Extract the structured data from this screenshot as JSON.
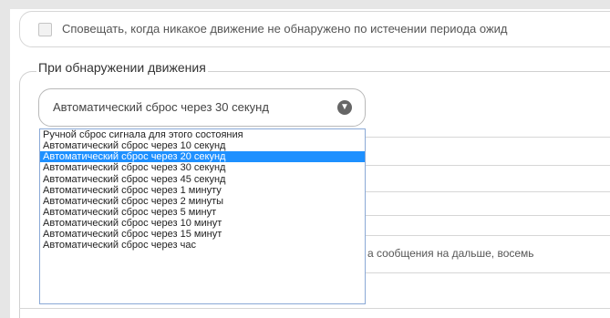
{
  "notify": {
    "label": "Сповещать, когда никакое движение не обнаружено по истечении периода ожид"
  },
  "section": {
    "title": "При обнаружении движения"
  },
  "select": {
    "value": "Автоматический сброс через 30 секунд"
  },
  "dropdown": {
    "options": [
      "Ручной сброс сигнала для этого состояния",
      "Автоматический сброс через 10 секунд",
      "Автоматический сброс через 20 секунд",
      "Автоматический сброс через 30 секунд",
      "Автоматический сброс через 45 секунд",
      "Автоматический сброс через 1 минуту",
      "Автоматический сброс через 2 минуты",
      "Автоматический сброс через 5 минут",
      "Автоматический сброс через 10 минут",
      "Автоматический сброс через 15 минут",
      "Автоматический сброс через час"
    ],
    "selected_index": 2
  },
  "background": {
    "partial_text": "а сообщения на дальше, восемь"
  },
  "colors": {
    "selection": "#1e90ff",
    "dropdown_border": "#8aa9d6",
    "frame": "#e6e6e6"
  }
}
